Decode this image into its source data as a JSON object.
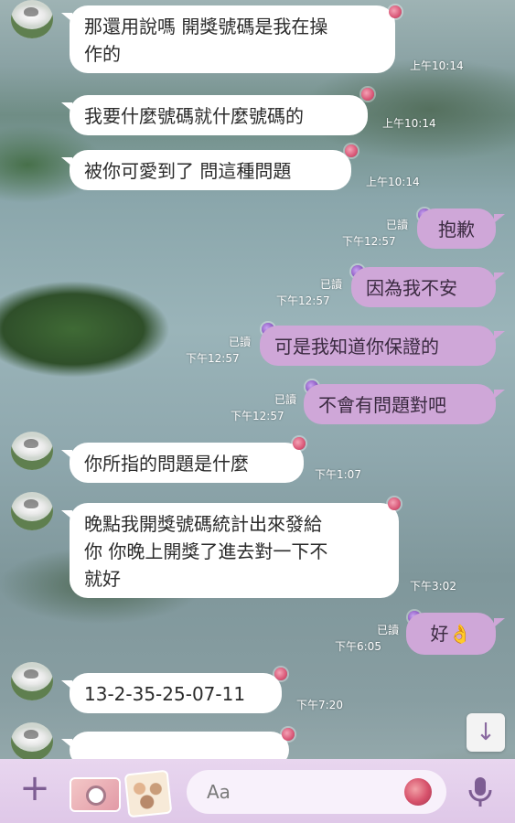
{
  "messages": [
    {
      "dir": "in",
      "avatar": true,
      "text": "那還用說嗎 開獎號碼是我在操\n作的",
      "time": "上午10:14",
      "read": ""
    },
    {
      "dir": "in",
      "avatar": false,
      "text": "我要什麼號碼就什麼號碼的",
      "time": "上午10:14",
      "read": ""
    },
    {
      "dir": "in",
      "avatar": false,
      "text": "被你可愛到了 問這種問題",
      "time": "上午10:14",
      "read": ""
    },
    {
      "dir": "out",
      "text": "抱歉",
      "time": "下午12:57",
      "read": "已讀"
    },
    {
      "dir": "out",
      "text": "因為我不安",
      "time": "下午12:57",
      "read": "已讀"
    },
    {
      "dir": "out",
      "text": "可是我知道你保證的",
      "time": "下午12:57",
      "read": "已讀"
    },
    {
      "dir": "out",
      "text": "不會有問題對吧",
      "time": "下午12:57",
      "read": "已讀"
    },
    {
      "dir": "in",
      "avatar": true,
      "text": "你所指的問題是什麼",
      "time": "下午1:07",
      "read": ""
    },
    {
      "dir": "in",
      "avatar": true,
      "text": "晚點我開獎號碼統計出來發給\n你 你晚上開獎了進去對一下不\n就好",
      "time": "下午3:02",
      "read": ""
    },
    {
      "dir": "out",
      "text": "好👌",
      "time": "下午6:05",
      "read": "已讀"
    },
    {
      "dir": "in",
      "avatar": true,
      "text": "13-2-35-25-07-11",
      "time": "下午7:20",
      "read": ""
    }
  ],
  "input": {
    "placeholder": "Aa"
  },
  "icons": {
    "scroll_down": "arrow-down-icon",
    "plus": "plus-icon",
    "camera": "camera-icon",
    "photo": "photo-icon",
    "sticker": "sticker-icon",
    "mic": "microphone-icon"
  },
  "colors": {
    "outgoing_bubble": "#cfa7d8",
    "incoming_bubble": "#ffffff",
    "input_bar": "#e3cfea"
  }
}
